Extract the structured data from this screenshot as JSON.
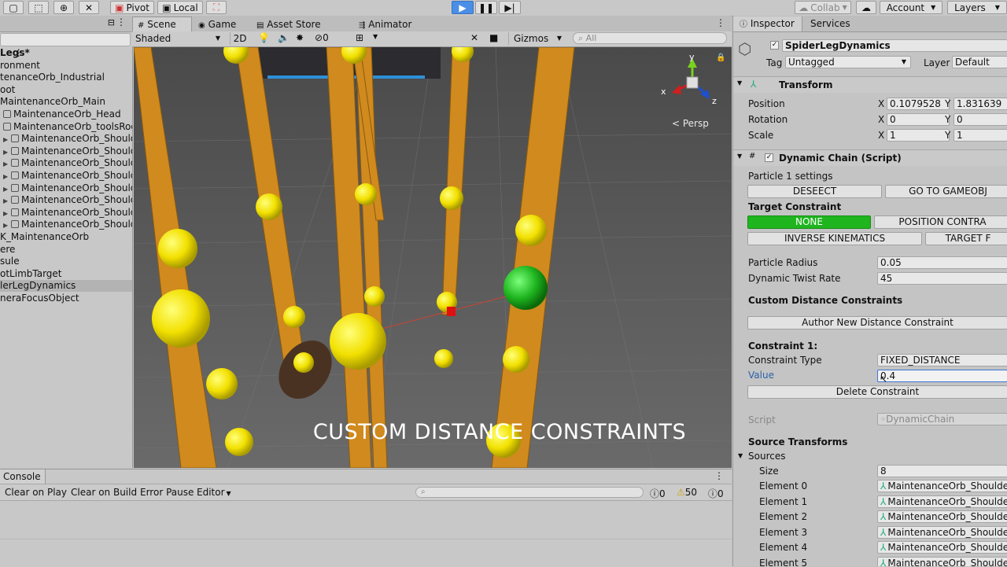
{
  "toolbar": {
    "pivot": "Pivot",
    "local": "Local",
    "collab": "Collab",
    "account": "Account",
    "layers": "Layers"
  },
  "hierarchy": {
    "items": [
      {
        "label": "Legs*",
        "bold": true,
        "arrow": false,
        "icon": false,
        "indent": 0
      },
      {
        "label": "ronment",
        "arrow": false,
        "icon": false,
        "indent": 0
      },
      {
        "label": "tenanceOrb_Industrial",
        "arrow": false,
        "icon": false,
        "indent": 0
      },
      {
        "label": "oot",
        "arrow": false,
        "icon": false,
        "indent": 0
      },
      {
        "label": "MaintenanceOrb_Main",
        "arrow": false,
        "icon": false,
        "indent": 0
      },
      {
        "label": "MaintenanceOrb_Head",
        "arrow": false,
        "icon": true,
        "indent": 4
      },
      {
        "label": "MaintenanceOrb_toolsRoot",
        "arrow": false,
        "icon": true,
        "indent": 4
      },
      {
        "label": "MaintenanceOrb_Should",
        "arrow": true,
        "icon": true,
        "indent": 4
      },
      {
        "label": "MaintenanceOrb_Should",
        "arrow": true,
        "icon": true,
        "indent": 4
      },
      {
        "label": "MaintenanceOrb_Should",
        "arrow": true,
        "icon": true,
        "indent": 4
      },
      {
        "label": "MaintenanceOrb_Should",
        "arrow": true,
        "icon": true,
        "indent": 4
      },
      {
        "label": "MaintenanceOrb_Should",
        "arrow": true,
        "icon": true,
        "indent": 4
      },
      {
        "label": "MaintenanceOrb_Should",
        "arrow": true,
        "icon": true,
        "indent": 4
      },
      {
        "label": "MaintenanceOrb_Should",
        "arrow": true,
        "icon": true,
        "indent": 4
      },
      {
        "label": "MaintenanceOrb_Should",
        "arrow": true,
        "icon": true,
        "indent": 4
      },
      {
        "label": "K_MaintenanceOrb",
        "arrow": false,
        "icon": false,
        "indent": 0
      },
      {
        "label": "ere",
        "arrow": false,
        "icon": false,
        "indent": 0
      },
      {
        "label": "sule",
        "arrow": false,
        "icon": false,
        "indent": 0
      },
      {
        "label": "otLimbTarget",
        "arrow": false,
        "icon": false,
        "indent": 0
      },
      {
        "label": "lerLegDynamics",
        "arrow": false,
        "icon": false,
        "indent": 0,
        "selected": true
      },
      {
        "label": "neraFocusObject",
        "arrow": false,
        "icon": false,
        "indent": 0
      }
    ]
  },
  "scene": {
    "tabs": [
      "Scene",
      "Game",
      "Asset Store",
      "Animator"
    ],
    "shading": "Shaded",
    "mode2d": "2D",
    "gizmos": "Gizmos",
    "search_placeholder": "All",
    "persp": "< Persp",
    "axes": {
      "x": "x",
      "y": "y",
      "z": "z"
    },
    "caption": "CUSTOM DISTANCE CONSTRAINTS",
    "layer_count": "0"
  },
  "console": {
    "title": "Console",
    "buttons": [
      "Clear on Play",
      "Clear on Build",
      "Error Pause",
      "Editor"
    ],
    "counts": {
      "info": "0",
      "warn": "50",
      "error": "0"
    }
  },
  "inspector": {
    "tabs": [
      "Inspector",
      "Services"
    ],
    "object_name": "SpiderLegDynamics",
    "tag_label": "Tag",
    "tag_value": "Untagged",
    "layer_label": "Layer",
    "layer_value": "Default",
    "transform": {
      "title": "Transform",
      "rows": [
        {
          "label": "Position",
          "x": "0.1079528",
          "y": "1.831639"
        },
        {
          "label": "Rotation",
          "x": "0",
          "y": "0"
        },
        {
          "label": "Scale",
          "x": "1",
          "y": "1"
        }
      ]
    },
    "chain": {
      "title": "Dynamic Chain (Script)",
      "particle_settings": "Particle 1 settings",
      "deselect": "DESEECT",
      "goto": "GO TO GAMEOBJ",
      "target_constraint": "Target Constraint",
      "none": "NONE",
      "position": "POSITION CONTRA",
      "ik": "INVERSE KINEMATICS",
      "target_f": "TARGET F",
      "radius_label": "Particle Radius",
      "radius_value": "0.05",
      "twist_label": "Dynamic Twist Rate",
      "twist_value": "45",
      "custom_title": "Custom Distance Constraints",
      "author_btn": "Author New Distance Constraint",
      "constraint_title": "Constraint 1:",
      "type_label": "Constraint Type",
      "type_value": "FIXED_DISTANCE",
      "value_label": "Value",
      "value_value": "0.4",
      "delete_btn": "Delete Constraint",
      "script_label": "Script",
      "script_value": "DynamicChain",
      "source_title": "Source Transforms",
      "sources_label": "Sources",
      "size_label": "Size",
      "size_value": "8",
      "elements": [
        {
          "label": "Element 0",
          "value": "MaintenanceOrb_Shoulder"
        },
        {
          "label": "Element 1",
          "value": "MaintenanceOrb_Shoulder"
        },
        {
          "label": "Element 2",
          "value": "MaintenanceOrb_Shoulder"
        },
        {
          "label": "Element 3",
          "value": "MaintenanceOrb_Shoulder"
        },
        {
          "label": "Element 4",
          "value": "MaintenanceOrb_Shoulder"
        },
        {
          "label": "Element 5",
          "value": "MaintenanceOrb_Shoulder"
        }
      ]
    }
  },
  "colors": {
    "play": "#4a8ee6",
    "green": "#1fb51f",
    "sphere": "#f2e600",
    "leg": "#d08a1e"
  }
}
